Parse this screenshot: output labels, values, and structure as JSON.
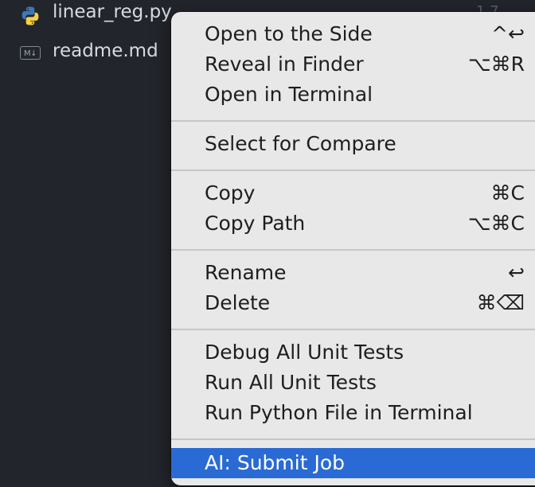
{
  "explorer": {
    "files": [
      {
        "name": "linear_reg.py",
        "icon": "python-icon"
      },
      {
        "name": "readme.md",
        "icon": "markdown-icon",
        "icon_text": "M↓"
      }
    ],
    "count_hint": "1 7"
  },
  "context_menu": {
    "groups": [
      [
        {
          "label": "Open to the Side",
          "shortcut": "^↩"
        },
        {
          "label": "Reveal in Finder",
          "shortcut": "⌥⌘R"
        },
        {
          "label": "Open in Terminal",
          "shortcut": ""
        }
      ],
      [
        {
          "label": "Select for Compare",
          "shortcut": ""
        }
      ],
      [
        {
          "label": "Copy",
          "shortcut": "⌘C"
        },
        {
          "label": "Copy Path",
          "shortcut": "⌥⌘C"
        }
      ],
      [
        {
          "label": "Rename",
          "shortcut": "↩"
        },
        {
          "label": "Delete",
          "shortcut": "⌘⌫"
        }
      ],
      [
        {
          "label": "Debug All Unit Tests",
          "shortcut": ""
        },
        {
          "label": "Run All Unit Tests",
          "shortcut": ""
        },
        {
          "label": "Run Python File in Terminal",
          "shortcut": ""
        }
      ],
      [
        {
          "label": "AI: Submit Job",
          "shortcut": "",
          "highlighted": true
        }
      ]
    ]
  },
  "colors": {
    "editor_background": "#22252b",
    "menu_background": "#e8e8e8",
    "highlight": "#2a6ad4",
    "python_blue": "#3d78b5",
    "python_yellow": "#f5cf45"
  }
}
